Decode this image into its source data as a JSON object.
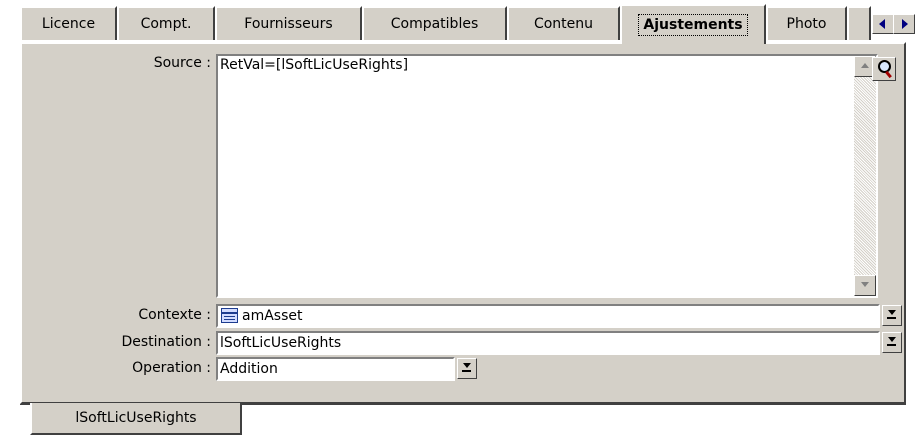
{
  "tabs": [
    {
      "label": "Licence",
      "active": false
    },
    {
      "label": "Compt.",
      "active": false
    },
    {
      "label": "Fournisseurs",
      "active": false
    },
    {
      "label": "Compatibles",
      "active": false
    },
    {
      "label": "Contenu",
      "active": false
    },
    {
      "label": "Ajustements",
      "active": true
    },
    {
      "label": "Photo",
      "active": false
    }
  ],
  "form": {
    "source": {
      "label": "Source :",
      "value": "RetVal=[lSoftLicUseRights]"
    },
    "contexte": {
      "label": "Contexte :",
      "value": "amAsset",
      "icon": "table-icon"
    },
    "destination": {
      "label": "Destination :",
      "value": "lSoftLicUseRights"
    },
    "operation": {
      "label": "Operation :",
      "value": "Addition"
    }
  },
  "bottom_tab": {
    "label": "lSoftLicUseRights"
  },
  "colors": {
    "face": "#d4d0c8",
    "highlight": "#ffffff",
    "shadow": "#808080",
    "dark_shadow": "#404040",
    "arrow": "#000080"
  }
}
